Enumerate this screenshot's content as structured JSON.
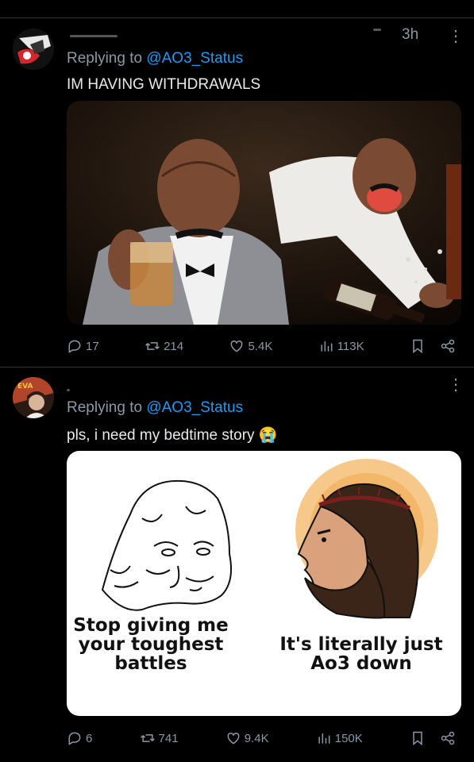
{
  "tweets": [
    {
      "time": "3h",
      "reply_prefix": "Replying to ",
      "reply_handle": "@AO3_Status",
      "text": "IM HAVING WITHDRAWALS",
      "stats": {
        "replies": "17",
        "reposts": "214",
        "likes": "5.4K",
        "views": "113K"
      }
    },
    {
      "reply_prefix": "Replying to ",
      "reply_handle": "@AO3_Status",
      "text": "pls, i need my bedtime story",
      "emoji": "😭",
      "meme": {
        "left_caption": "Stop giving me your toughest battles",
        "right_caption": "It's literally just Ao3 down"
      },
      "stats": {
        "replies": "6",
        "reposts": "741",
        "likes": "9.4K",
        "views": "150K"
      }
    }
  ],
  "icons": [
    "reply-icon",
    "repost-icon",
    "like-icon",
    "views-icon",
    "bookmark-icon",
    "share-icon",
    "more-icon"
  ],
  "colors": {
    "link": "#1d9bf0",
    "muted": "#8b98a5",
    "text": "#e7e9ea",
    "background": "#000000"
  }
}
